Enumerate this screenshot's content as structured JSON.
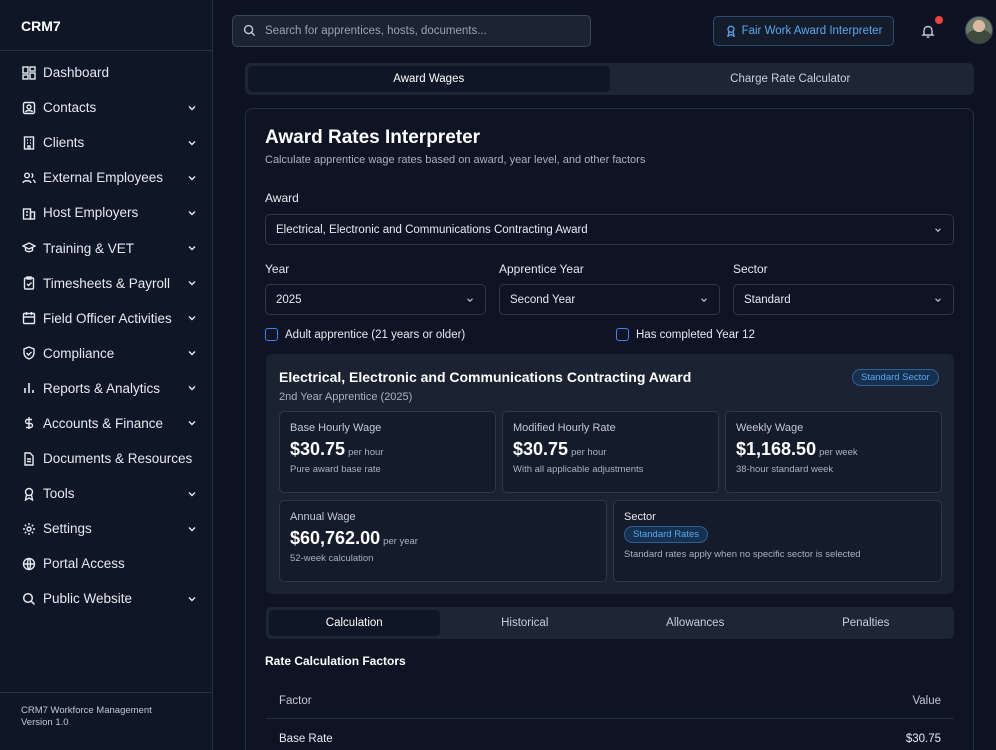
{
  "brand": "CRM7",
  "sidebar": {
    "items": [
      {
        "label": "Dashboard",
        "icon": "grid-icon",
        "chevron": false
      },
      {
        "label": "Contacts",
        "icon": "contact-card-icon",
        "chevron": true
      },
      {
        "label": "Clients",
        "icon": "building-icon",
        "chevron": true
      },
      {
        "label": "External Employees",
        "icon": "users-icon",
        "chevron": true
      },
      {
        "label": "Host Employers",
        "icon": "buildings-icon",
        "chevron": true
      },
      {
        "label": "Training & VET",
        "icon": "graduation-cap-icon",
        "chevron": true
      },
      {
        "label": "Timesheets & Payroll",
        "icon": "clipboard-icon",
        "chevron": true
      },
      {
        "label": "Field Officer Activities",
        "icon": "calendar-icon",
        "chevron": true
      },
      {
        "label": "Compliance",
        "icon": "shield-check-icon",
        "chevron": true
      },
      {
        "label": "Reports & Analytics",
        "icon": "bar-chart-icon",
        "chevron": true
      },
      {
        "label": "Accounts & Finance",
        "icon": "dollar-icon",
        "chevron": true
      },
      {
        "label": "Documents & Resources",
        "icon": "document-icon",
        "chevron": false
      },
      {
        "label": "Tools",
        "icon": "award-icon",
        "chevron": true
      },
      {
        "label": "Settings",
        "icon": "gear-icon",
        "chevron": true
      },
      {
        "label": "Portal Access",
        "icon": "globe-icon",
        "chevron": false
      },
      {
        "label": "Public Website",
        "icon": "search-icon",
        "chevron": true
      }
    ],
    "footer_line1": "CRM7 Workforce Management",
    "footer_line2": "Version 1.0"
  },
  "header": {
    "search_placeholder": "Search for apprentices, hosts, documents...",
    "fair_work_button": "Fair Work Award Interpreter"
  },
  "top_tabs": [
    "Award Wages",
    "Charge Rate Calculator"
  ],
  "main": {
    "title": "Award Rates Interpreter",
    "subtitle": "Calculate apprentice wage rates based on award, year level, and other factors",
    "award_label": "Award",
    "award_value": "Electrical, Electronic and Communications Contracting Award",
    "year_label": "Year",
    "year_value": "2025",
    "app_year_label": "Apprentice Year",
    "app_year_value": "Second Year",
    "sector_label": "Sector",
    "sector_value": "Standard",
    "check_adult": "Adult apprentice (21 years or older)",
    "check_year12": "Has completed Year 12"
  },
  "result": {
    "title": "Electrical, Electronic and Communications Contracting Award",
    "subtitle": "2nd Year Apprentice (2025)",
    "badge": "Standard Sector",
    "base_label": "Base Hourly Wage",
    "base_value": "$30.75",
    "base_unit": "per hour",
    "base_note": "Pure award base rate",
    "mod_label": "Modified Hourly Rate",
    "mod_value": "$30.75",
    "mod_unit": "per hour",
    "mod_note": "With all applicable adjustments",
    "weekly_label": "Weekly Wage",
    "weekly_value": "$1,168.50",
    "weekly_unit": "per week",
    "weekly_note": "38-hour standard week",
    "annual_label": "Annual Wage",
    "annual_value": "$60,762.00",
    "annual_unit": "per year",
    "annual_note": "52-week calculation",
    "sector_label": "Sector",
    "sector_badge": "Standard Rates",
    "sector_note": "Standard rates apply when no specific sector is selected"
  },
  "bottom_tabs": [
    "Calculation",
    "Historical",
    "Allowances",
    "Penalties"
  ],
  "factors": {
    "title": "Rate Calculation Factors",
    "col_factor": "Factor",
    "col_value": "Value",
    "rows": [
      {
        "factor": "Base Rate",
        "value": "$30.75"
      }
    ]
  }
}
